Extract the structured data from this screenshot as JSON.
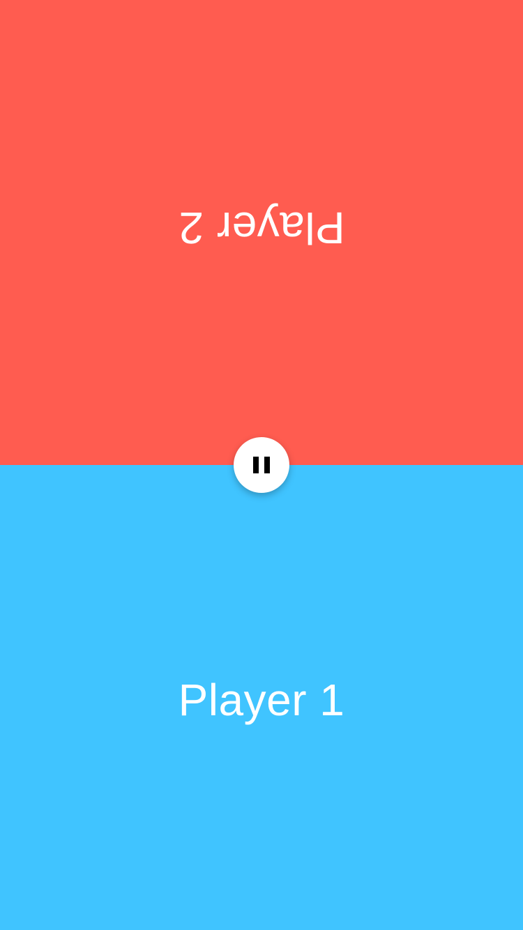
{
  "colors": {
    "player2_panel": "#FF5C50",
    "player1_panel": "#40C4FF",
    "label_text": "#FFFFFF",
    "pause_button_bg": "#FFFFFF",
    "pause_icon": "#000000"
  },
  "player2": {
    "label": "Player 2"
  },
  "player1": {
    "label": "Player 1"
  },
  "controls": {
    "pause_icon": "pause-icon"
  }
}
